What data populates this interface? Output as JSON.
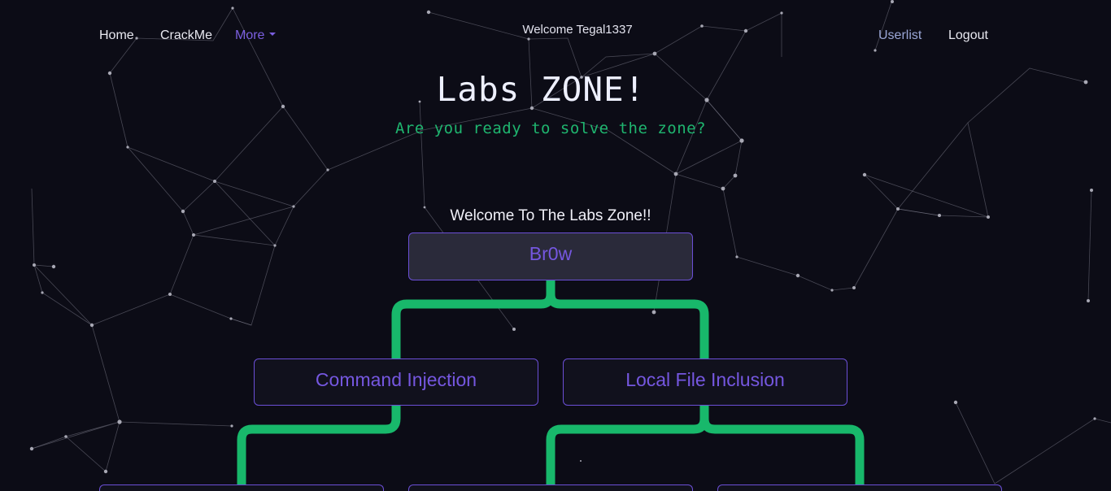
{
  "nav": {
    "home": "Home",
    "crackme": "CrackMe",
    "more": "More",
    "welcome": "Welcome Tegal1337",
    "userlist": "Userlist",
    "logout": "Logout"
  },
  "hero": {
    "title": "Labs ZONE!",
    "subtitle": "Are you ready to solve the zone?"
  },
  "tree": {
    "intro": "Welcome To The Labs Zone!!",
    "root": "Br0w",
    "level1": [
      "Command Injection",
      "Local File Inclusion"
    ]
  },
  "colors": {
    "background": "#0c0c16",
    "accent": "#7557e0",
    "green": "#1fb56f",
    "node_border": "#6b4fd6"
  }
}
